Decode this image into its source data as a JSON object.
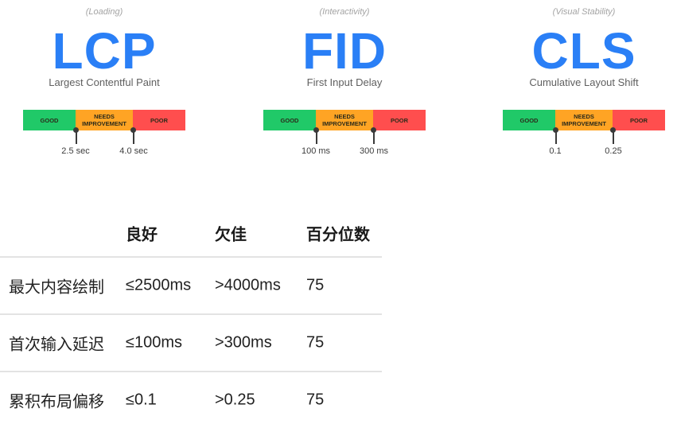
{
  "metrics": [
    {
      "category": "(Loading)",
      "abbr": "LCP",
      "name": "Largest Contentful Paint",
      "segments": {
        "good": "GOOD",
        "needs_1": "NEEDS",
        "needs_2": "IMPROVEMENT",
        "poor": "POOR"
      },
      "thresholds": [
        "2.5 sec",
        "4.0 sec"
      ]
    },
    {
      "category": "(Interactivity)",
      "abbr": "FID",
      "name": "First Input Delay",
      "segments": {
        "good": "GOOD",
        "needs_1": "NEEDS",
        "needs_2": "IMPROVEMENT",
        "poor": "POOR"
      },
      "thresholds": [
        "100 ms",
        "300 ms"
      ]
    },
    {
      "category": "(Visual Stability)",
      "abbr": "CLS",
      "name": "Cumulative Layout Shift",
      "segments": {
        "good": "GOOD",
        "needs_1": "NEEDS",
        "needs_2": "IMPROVEMENT",
        "poor": "POOR"
      },
      "thresholds": [
        "0.1",
        "0.25"
      ]
    }
  ],
  "colors": {
    "accent_blue": "#2a7ff6",
    "good": "#20c968",
    "needs_improvement": "#ffa424",
    "poor": "#ff4e4e"
  },
  "table": {
    "headers": [
      "",
      "良好",
      "欠佳",
      "百分位数"
    ],
    "rows": [
      [
        "最大内容绘制",
        "≤2500ms",
        ">4000ms",
        "75"
      ],
      [
        "首次输入延迟",
        "≤100ms",
        ">300ms",
        "75"
      ],
      [
        "累积布局偏移",
        "≤0.1",
        ">0.25",
        "75"
      ]
    ]
  }
}
